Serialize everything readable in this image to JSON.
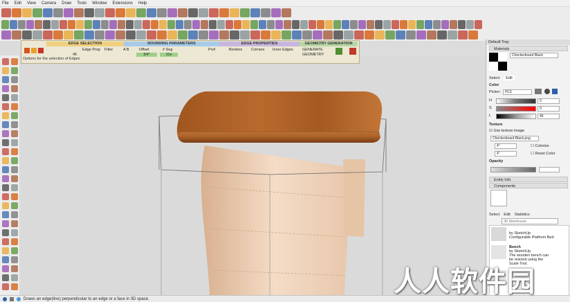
{
  "menu": [
    "File",
    "Edit",
    "View",
    "Camera",
    "Draw",
    "Tools",
    "Window",
    "Extensions",
    "Help"
  ],
  "extension": {
    "sections": [
      "EDGE SELECTION",
      "ROUNDING PARAMETERS",
      "EDGE PROPERTIES",
      "GEOMETRY GENERATION"
    ],
    "labels": {
      "edge_prop": "Edge Prop",
      "filter": "Filter",
      "ab": "A B",
      "offset": "Offset",
      "offset_value": "3/4\"",
      "seg": "# Seg",
      "seg_value": "11s",
      "prof": "Prof",
      "borders": "Borders",
      "corners": "Corners",
      "inner_edges": "Inner Edges",
      "generate": "GENERATE",
      "geometry": "GEOMETRY",
      "count": "45"
    },
    "hint": "Options for the selection of Edges"
  },
  "tray": {
    "title": "Default Tray",
    "materials_label": "Materials",
    "material_name": "Checkerboard Black",
    "tabs": [
      "Select",
      "Edit"
    ],
    "color_label": "Color",
    "picker_label": "Picker:",
    "picker_value": "HLS",
    "hls": [
      {
        "label": "H",
        "value": "0"
      },
      {
        "label": "S",
        "value": "0"
      },
      {
        "label": "L",
        "value": "46"
      }
    ],
    "texture_label": "Texture",
    "use_texture": "Use texture image",
    "texture_file": "Checkerboard Black.png",
    "dim_w": "4\"",
    "dim_h": "4\"",
    "colorize": "Colorize",
    "reset_color": "Reset Color",
    "opacity_label": "Opacity",
    "entity_info": "Entity Info",
    "components": "Components",
    "comp_tabs": [
      "Select",
      "Edit",
      "Statistics"
    ],
    "search_placeholder": "3D Warehouse",
    "items": [
      {
        "title": "",
        "by": "by SketchUp",
        "desc": "Configurable Platform Bed"
      },
      {
        "title": "Bench",
        "by": "by SketchUp",
        "desc": "The wooden bench can be resized using the Scale Tool."
      },
      {
        "title": "",
        "by": "",
        "desc": ""
      }
    ]
  },
  "status": {
    "text": "Draws an edge(line) perpendicular to an edge or a face in 3D space."
  },
  "watermark": "人人软件园"
}
